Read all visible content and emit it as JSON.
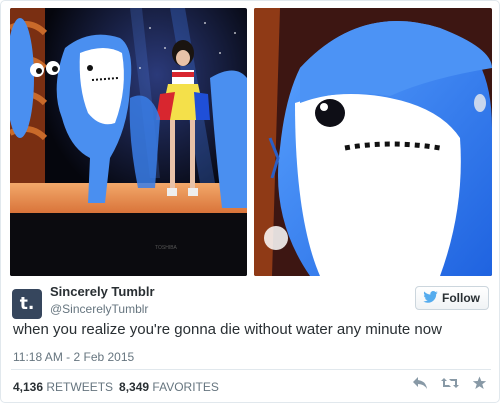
{
  "tweet": {
    "author": {
      "name": "Sincerely Tumblr",
      "handle": "@SincerelyTumblr",
      "avatar_letter": "t."
    },
    "follow_label": "Follow",
    "text": "when you realize you're gonna die without water any minute now",
    "timestamp": "11:18 AM - 2 Feb 2015",
    "stats": {
      "retweets_count": "4,136",
      "retweets_label": "RETWEETS",
      "favorites_count": "8,349",
      "favorites_label": "FAVORITES"
    },
    "media": {
      "left_image": "stage-performance-with-shark-dancer",
      "right_image": "close-up-shark-costume-face",
      "tv_brand": "TOSHIBA"
    },
    "icons": {
      "follow": "bird-icon",
      "reply": "reply-icon",
      "retweet": "retweet-icon",
      "favorite": "star-icon"
    },
    "colors": {
      "accent": "#55acee",
      "text": "#292f33",
      "muted": "#66757f",
      "avatar_bg": "#36465d"
    }
  }
}
